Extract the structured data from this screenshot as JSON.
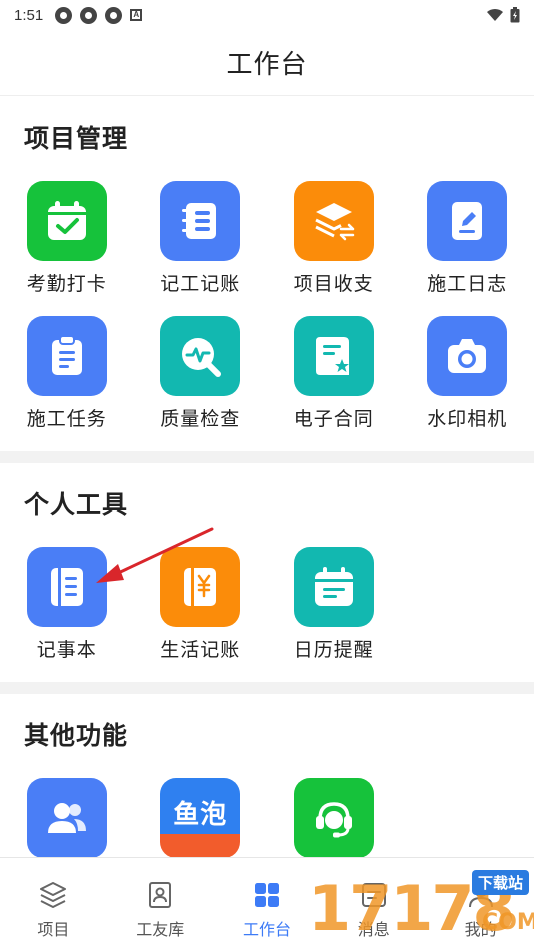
{
  "status_bar": {
    "time": "1:51"
  },
  "header": {
    "title": "工作台"
  },
  "colors": {
    "green": "#16c23b",
    "blue": "#4a7ef6",
    "orange": "#fb8c0a",
    "teal": "#12b8b0",
    "active_tab": "#3d7bf6",
    "arrow": "#d9262b"
  },
  "sections": {
    "project": {
      "title": "项目管理",
      "items": [
        {
          "label": "考勤打卡",
          "icon": "calendar-check-icon",
          "color": "#16c23b"
        },
        {
          "label": "记工记账",
          "icon": "notebook-list-icon",
          "color": "#4a7ef6"
        },
        {
          "label": "项目收支",
          "icon": "layers-exchange-icon",
          "color": "#fb8c0a"
        },
        {
          "label": "施工日志",
          "icon": "document-edit-icon",
          "color": "#4a7ef6"
        },
        {
          "label": "施工任务",
          "icon": "clipboard-icon",
          "color": "#4a7ef6"
        },
        {
          "label": "质量检查",
          "icon": "magnifier-pulse-icon",
          "color": "#12b8b0"
        },
        {
          "label": "电子合同",
          "icon": "contract-star-icon",
          "color": "#12b8b0"
        },
        {
          "label": "水印相机",
          "icon": "camera-icon",
          "color": "#4a7ef6"
        }
      ]
    },
    "personal": {
      "title": "个人工具",
      "items": [
        {
          "label": "记事本",
          "icon": "notepad-icon",
          "color": "#4a7ef6"
        },
        {
          "label": "生活记账",
          "icon": "yuan-ledger-icon",
          "color": "#fb8c0a"
        },
        {
          "label": "日历提醒",
          "icon": "calendar-icon",
          "color": "#12b8b0"
        }
      ]
    },
    "other": {
      "title": "其他功能",
      "items": [
        {
          "label": "",
          "icon": "users-icon",
          "color": "#4a7ef6"
        },
        {
          "label": "",
          "icon": "yupao-logo-icon",
          "color": "#2f80f0",
          "logo_text": "鱼泡"
        },
        {
          "label": "",
          "icon": "headset-support-icon",
          "color": "#16c23b"
        }
      ]
    }
  },
  "tabs": [
    {
      "label": "项目",
      "icon": "layers-icon",
      "active": false
    },
    {
      "label": "工友库",
      "icon": "contact-card-icon",
      "active": false
    },
    {
      "label": "工作台",
      "icon": "grid-icon",
      "active": true
    },
    {
      "label": "消息",
      "icon": "message-icon",
      "active": false
    },
    {
      "label": "我的",
      "icon": "user-icon",
      "active": false
    }
  ],
  "watermark": {
    "text": "17178",
    "badge": "下载站",
    "sub": "COM"
  }
}
